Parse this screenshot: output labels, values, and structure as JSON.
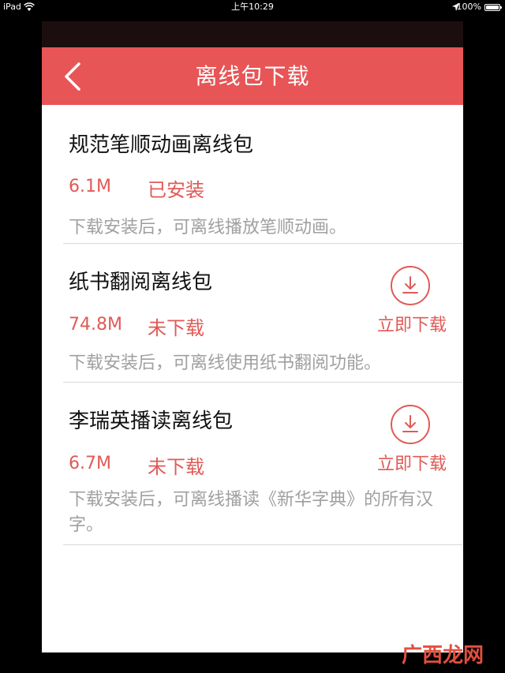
{
  "status_bar": {
    "device": "iPad",
    "time": "上午10:29",
    "battery": "100%"
  },
  "header": {
    "title": "离线包下载",
    "back_icon": "chevron-left-icon"
  },
  "packages": [
    {
      "title": "规范笔顺动画离线包",
      "size": "6.1M",
      "status": "已安装",
      "description": "下载安装后，可离线播放笔顺动画。"
    },
    {
      "title": "纸书翻阅离线包",
      "size": "74.8M",
      "status": "未下载",
      "description": "下载安装后，可离线使用纸书翻阅功能。",
      "action_label": "立即下载",
      "action_icon": "download-icon"
    },
    {
      "title": "李瑞英播读离线包",
      "size": "6.7M",
      "status": "未下载",
      "description": "下载安装后，可离线播读《新华字典》的所有汉字。",
      "action_label": "立即下载",
      "action_icon": "download-icon"
    }
  ],
  "watermark": "广西龙网",
  "colors": {
    "accent": "#e75556",
    "status_text": "#e05a57",
    "description_text": "#a0a0a0",
    "title_text": "#111111"
  }
}
